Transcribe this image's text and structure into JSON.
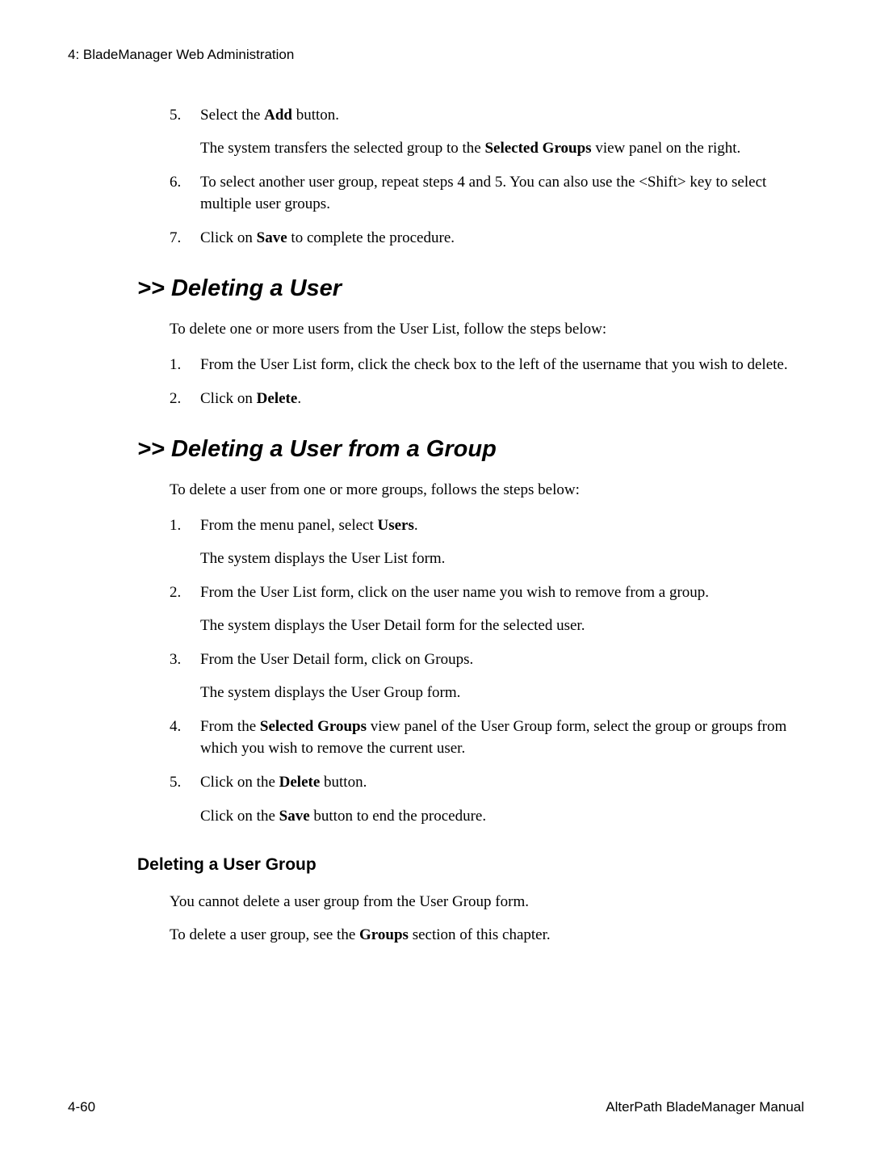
{
  "header": {
    "chapter": "4: BladeManager Web Administration"
  },
  "top_list": {
    "item5_num": "5.",
    "item5_a": "Select the ",
    "item5_b": "Add",
    "item5_c": " button.",
    "item5_sub_a": "The system transfers the selected group to the ",
    "item5_sub_b": "Selected Groups",
    "item5_sub_c": " view panel on the right.",
    "item6_num": "6.",
    "item6": "To select another user group, repeat steps 4 and 5. You can also use the <Shift> key to select multiple user groups.",
    "item7_num": "7.",
    "item7_a": "Click on ",
    "item7_b": "Save",
    "item7_c": " to complete the procedure."
  },
  "sec1": {
    "title_prefix": ">> ",
    "title": "Deleting a User",
    "intro": "To delete one or more users from the User List, follow the steps below:",
    "item1_num": "1.",
    "item1": "From the User List form, click the check box to the left of the username that you wish to delete.",
    "item2_num": "2.",
    "item2_a": "Click on ",
    "item2_b": "Delete",
    "item2_c": "."
  },
  "sec2": {
    "title_prefix": ">> ",
    "title": "Deleting a User from a Group",
    "intro": "To delete a user from one or more groups, follows the steps below:",
    "item1_num": "1.",
    "item1_a": "From the menu panel, select ",
    "item1_b": "Users",
    "item1_c": ".",
    "item1_sub": "The system displays the User List form.",
    "item2_num": "2.",
    "item2": "From the User List form, click on the user name you wish to remove from a group.",
    "item2_sub": "The system displays the User Detail form for the selected user.",
    "item3_num": "3.",
    "item3": "From the User Detail form, click on Groups.",
    "item3_sub": "The system displays the User Group form.",
    "item4_num": "4.",
    "item4_a": "From the ",
    "item4_b": "Selected Groups",
    "item4_c": " view panel of the User Group form, select the group or groups from which you wish to remove the current user.",
    "item5_num": "5.",
    "item5_a": "Click on the ",
    "item5_b": "Delete",
    "item5_c": " button.",
    "item5_sub_a": "Click on the ",
    "item5_sub_b": "Save",
    "item5_sub_c": " button to end the procedure."
  },
  "sec3": {
    "title": "Deleting a User Group",
    "p1": "You cannot delete a user group from the User Group form.",
    "p2_a": "To delete a user group, see the ",
    "p2_b": "Groups",
    "p2_c": " section of this chapter."
  },
  "footer": {
    "page": "4-60",
    "manual": "AlterPath BladeManager Manual"
  }
}
